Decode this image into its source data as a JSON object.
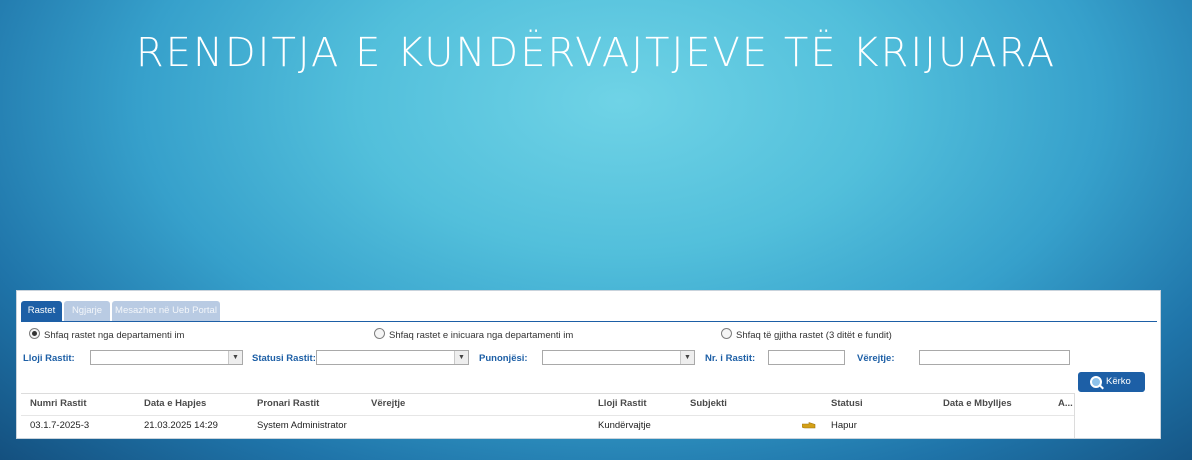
{
  "slide": {
    "title": "RENDITJA E KUNDËRVAJTJEVE TË KRIJUARA"
  },
  "tabs": [
    {
      "label": "Rastet",
      "active": true
    },
    {
      "label": "Ngjarje",
      "active": false
    },
    {
      "label": "Mesazhet në Ueb Portal",
      "active": false
    }
  ],
  "radios": [
    {
      "label": "Shfaq rastet nga departamenti im",
      "checked": true
    },
    {
      "label": "Shfaq rastet e inicuara nga departamenti im",
      "checked": false
    },
    {
      "label": "Shfaq të gjitha rastet (3 ditët e fundit)",
      "checked": false
    }
  ],
  "filters": {
    "case_type_label": "Lloji Rastit:",
    "case_status_label": "Statusi Rastit:",
    "employee_label": "Punonjësi:",
    "case_number_label": "Nr. i Rastit:",
    "remarks_label": "Vërejtje:",
    "case_type_value": "",
    "case_status_value": "",
    "employee_value": "",
    "case_number_value": "",
    "remarks_value": ""
  },
  "search_button": {
    "label": "Kërko",
    "icon": "magnifier-icon"
  },
  "table": {
    "columns": [
      "Numri Rastit",
      "Data e Hapjes",
      "Pronari Rastit",
      "Vërejtje",
      "Lloji Rastit",
      "Subjekti",
      "Statusi",
      "Data e Mbylljes",
      "A..."
    ],
    "rows": [
      {
        "case_number": "03.1.7-2025-3",
        "open_date": "21.03.2025 14:29",
        "owner": "System Administrator",
        "remarks": "",
        "case_type": "Kundërvajtje",
        "subject": "",
        "status_icon": "hand-pointer-icon",
        "status": "Hapur",
        "close_date": ""
      }
    ]
  },
  "colors": {
    "accent": "#1d5fa6",
    "tab_inactive": "#b9cbe3",
    "status_icon": "#d4a017"
  }
}
